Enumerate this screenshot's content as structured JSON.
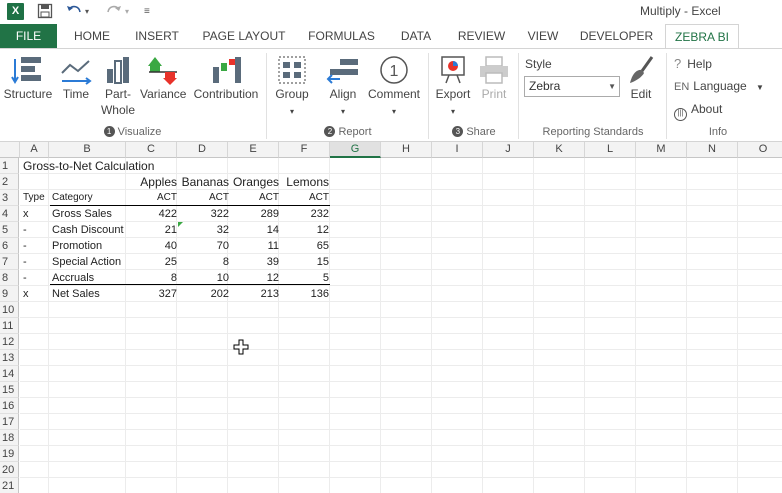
{
  "window": {
    "title": "Multiply - Excel",
    "logo": "X"
  },
  "quick_access": {
    "save_icon": "save-icon",
    "undo_icon": "undo-icon",
    "redo_icon": "redo-icon",
    "customize_icon": "customize-icon"
  },
  "tabs": [
    {
      "label": "FILE"
    },
    {
      "label": "HOME"
    },
    {
      "label": "INSERT"
    },
    {
      "label": "PAGE LAYOUT"
    },
    {
      "label": "FORMULAS"
    },
    {
      "label": "DATA"
    },
    {
      "label": "REVIEW"
    },
    {
      "label": "VIEW"
    },
    {
      "label": "DEVELOPER"
    },
    {
      "label": "ZEBRA BI"
    }
  ],
  "ribbon": {
    "visualize": {
      "structure": "Structure",
      "time": "Time",
      "part": "Part-",
      "whole": "Whole",
      "variance": "Variance",
      "contribution": "Contribution",
      "group_num": "1",
      "group_label": "Visualize"
    },
    "report": {
      "group": "Group",
      "align": "Align",
      "comment": "Comment",
      "group_num": "2",
      "group_label": "Report"
    },
    "share": {
      "export": "Export",
      "print": "Print",
      "group_num": "3",
      "group_label": "Share"
    },
    "reporting_standards": {
      "style_label": "Style",
      "style_value": "Zebra",
      "edit": "Edit",
      "group_label": "Reporting Standards"
    },
    "info": {
      "help": "Help",
      "language_prefix": "EN",
      "language": "Language",
      "about": "About",
      "group_label": "Info"
    }
  },
  "sheet": {
    "columns": [
      "A",
      "B",
      "C",
      "D",
      "E",
      "F",
      "G",
      "H",
      "I",
      "J",
      "K",
      "L",
      "M",
      "N",
      "O"
    ],
    "selected_column": "G",
    "rows": [
      "1",
      "2",
      "3",
      "4",
      "5",
      "6",
      "7",
      "8",
      "9",
      "10",
      "11",
      "12",
      "13",
      "14",
      "15",
      "16",
      "17",
      "18",
      "19",
      "20",
      "21"
    ],
    "title": "Gross-to-Net Calculation",
    "products": [
      "Apples",
      "Bananas",
      "Oranges",
      "Lemons"
    ],
    "header_type": "Type",
    "header_category": "Category",
    "scenario": [
      "ACT",
      "ACT",
      "ACT",
      "ACT"
    ],
    "data": [
      {
        "type": "x",
        "category": "Gross Sales",
        "values": [
          "422",
          "322",
          "289",
          "232"
        ]
      },
      {
        "type": "-",
        "category": "Cash Discount",
        "values": [
          "21",
          "32",
          "14",
          "12"
        ]
      },
      {
        "type": "-",
        "category": "Promotion",
        "values": [
          "40",
          "70",
          "11",
          "65"
        ]
      },
      {
        "type": "-",
        "category": "Special Action",
        "values": [
          "25",
          "8",
          "39",
          "15"
        ]
      },
      {
        "type": "-",
        "category": "Accruals",
        "values": [
          "8",
          "10",
          "12",
          "5"
        ]
      },
      {
        "type": "x",
        "category": "Net Sales",
        "values": [
          "327",
          "202",
          "213",
          "136"
        ]
      }
    ]
  },
  "colors": {
    "excel_green": "#217346",
    "variance_red": "#e8322a",
    "variance_green": "#3aa843"
  }
}
